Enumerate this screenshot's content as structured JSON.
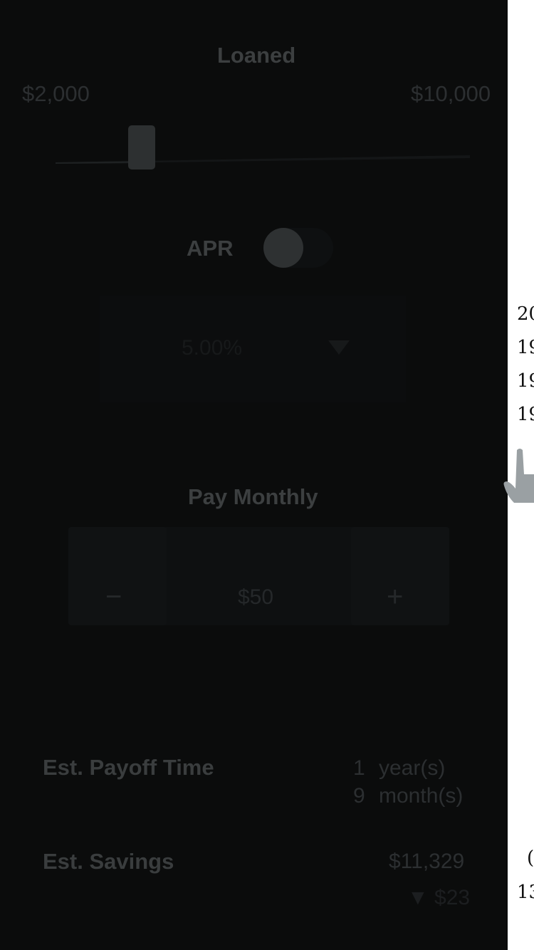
{
  "loan": {
    "title": "Loaned",
    "min_label": "$2,000",
    "max_label": "$10,000",
    "slider_fraction": 0.2
  },
  "apr": {
    "label": "APR",
    "toggle_on": false,
    "value": "5.00%"
  },
  "payment": {
    "title": "Pay Monthly",
    "minus": "−",
    "amount": "$50",
    "plus": "+"
  },
  "results": {
    "payoff_label": "Est. Payoff Time",
    "payoff_years": "1",
    "years_unit": "year(s)",
    "payoff_months": "9",
    "months_unit": "month(s)",
    "savings_label": "Est. Savings",
    "savings_value": "$11,329",
    "savings_delta": "▼ $23"
  },
  "behind": {
    "lines": [
      "20",
      "19",
      "19",
      "19"
    ],
    "paren": "(",
    "bottom": "13"
  },
  "colors": {
    "overlay_bg": "#0b0c0c",
    "text_dim": "#3c3f40",
    "hand": "#9aa0a3"
  }
}
